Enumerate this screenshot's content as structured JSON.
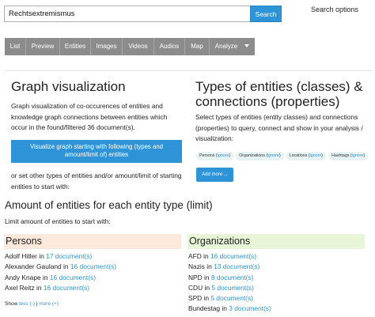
{
  "search": {
    "value": "Rechtsextremismus",
    "button_label": "Search",
    "options_label": "Search options"
  },
  "nav": {
    "tabs": [
      "List",
      "Preview",
      "Entities",
      "Images",
      "Videos",
      "Audios",
      "Map"
    ],
    "analyze_label": "Analyze"
  },
  "graph": {
    "title": "Graph visualization",
    "description_lines": [
      "Graph visualization of co-occurences of entities and",
      "knowledge graph connections between entities which",
      "occur in the found/filtered 36 document(s)."
    ],
    "button_lines": [
      "Visualize graph starting with following (types and",
      "amount/limit of) entities"
    ],
    "alt_lines": [
      "or set other types of entities and/or amount/limit of starting",
      "entities to start with:"
    ]
  },
  "types": {
    "title_lines": [
      "Types of entities (classes) &",
      "connections (properties)"
    ],
    "description_lines": [
      "Select types of entities (entity classes) and connections",
      "(properties) to query, connect and show in your analysis /",
      "visualization:"
    ],
    "chips": [
      {
        "label": "Persons",
        "ignore": "ignore"
      },
      {
        "label": "Organizations",
        "ignore": "ignore"
      },
      {
        "label": "Locations",
        "ignore": "ignore"
      },
      {
        "label": "Hashtags",
        "ignore": "ignore"
      }
    ],
    "add_more_label": "Add more ..."
  },
  "amount": {
    "title": "Amount of entities for each entity type (limit)",
    "subtitle": "Limit amount of entities to start with:"
  },
  "persons": {
    "header": "Persons",
    "header_color": "#fce9dc",
    "items": [
      {
        "name": "Adolf Hitler",
        "count": "17 document(s)"
      },
      {
        "name": "Alexander Gauland",
        "count": "16 document(s)"
      },
      {
        "name": "Andy Knape",
        "count": "16 document(s)"
      },
      {
        "name": "Axel Reitz",
        "count": "16 document(s)"
      }
    ],
    "show_label": "Show",
    "less_label": "less (-)",
    "separator": "|",
    "more_label": "more (+)"
  },
  "organizations": {
    "header": "Organizations",
    "header_color": "#e8f5d6",
    "items": [
      {
        "name": "AFD",
        "count": "16 document(s)"
      },
      {
        "name": "Nazis",
        "count": "13 document(s)"
      },
      {
        "name": "NPD",
        "count": "8 document(s)"
      },
      {
        "name": "CDU",
        "count": "5 document(s)"
      },
      {
        "name": "SPD",
        "count": "5 document(s)"
      },
      {
        "name": "Bundestag",
        "count": "3 document(s)"
      }
    ]
  },
  "connector": "in",
  "colors": {
    "accent": "#2f94d7",
    "nav_bg": "#8c8c8c",
    "chip_bg": "#e7f3f2"
  }
}
